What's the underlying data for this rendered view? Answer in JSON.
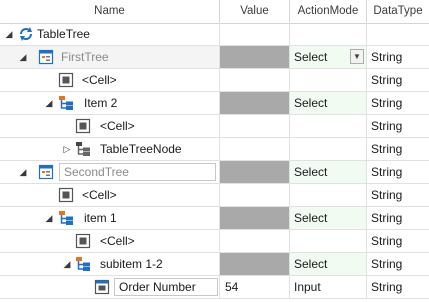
{
  "columns": {
    "name": "Name",
    "value": "Value",
    "action_mode": "ActionMode",
    "data_type": "DataType"
  },
  "rows": [
    {
      "name": "TableTree",
      "value": "",
      "action_mode": "",
      "data_type": "",
      "icon": "refresh-icon",
      "expander": "expanded"
    },
    {
      "name": "FirstTree",
      "value": "",
      "action_mode": "Select",
      "data_type": "String",
      "icon": "tree-list-icon",
      "expander": "expanded"
    },
    {
      "name": "<Cell>",
      "value": "",
      "action_mode": "",
      "data_type": "String",
      "icon": "cell-icon",
      "expander": "none"
    },
    {
      "name": "Item 2",
      "value": "",
      "action_mode": "Select",
      "data_type": "String",
      "icon": "tree-node-icon",
      "expander": "expanded"
    },
    {
      "name": "<Cell>",
      "value": "",
      "action_mode": "",
      "data_type": "String",
      "icon": "cell-icon",
      "expander": "none"
    },
    {
      "name": "TableTreeNode",
      "value": "",
      "action_mode": "",
      "data_type": "String",
      "icon": "tree-node-gray-icon",
      "expander": "collapsed"
    },
    {
      "name": "SecondTree",
      "value": "",
      "action_mode": "Select",
      "data_type": "String",
      "icon": "tree-list-icon",
      "expander": "expanded"
    },
    {
      "name": "<Cell>",
      "value": "",
      "action_mode": "",
      "data_type": "String",
      "icon": "cell-icon",
      "expander": "none"
    },
    {
      "name": "item 1",
      "value": "",
      "action_mode": "Select",
      "data_type": "String",
      "icon": "tree-node-icon",
      "expander": "expanded"
    },
    {
      "name": "<Cell>",
      "value": "",
      "action_mode": "",
      "data_type": "String",
      "icon": "cell-icon",
      "expander": "none"
    },
    {
      "name": "subitem 1-2",
      "value": "",
      "action_mode": "Select",
      "data_type": "String",
      "icon": "tree-node-icon",
      "expander": "expanded"
    },
    {
      "name": "Order Number",
      "value": "54",
      "action_mode": "Input",
      "data_type": "String",
      "icon": "cell-icon",
      "expander": "none"
    }
  ],
  "colors": {
    "accent_orange": "#e8751a",
    "accent_blue": "#1e6fc8",
    "value_gray": "#a9a9a9",
    "mode_green": "#f1fbf1"
  }
}
